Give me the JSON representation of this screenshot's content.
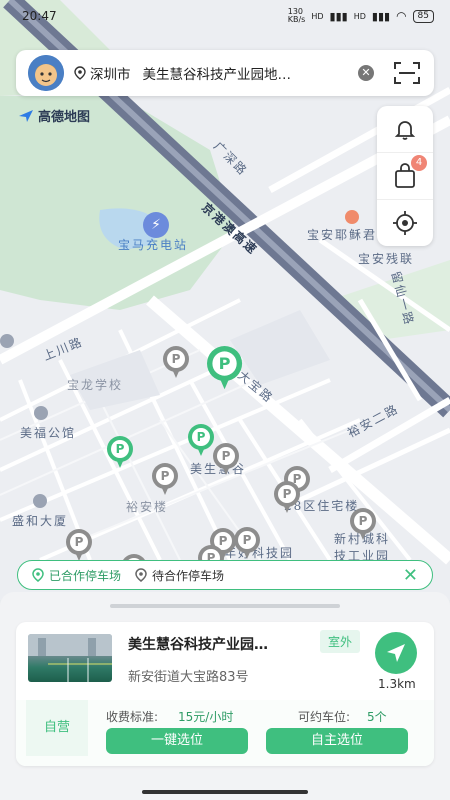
{
  "status_bar": {
    "time": "20:47",
    "net_speed": "130\nKB/s",
    "net1": "HD",
    "net2": "HD",
    "battery": "85"
  },
  "search": {
    "city": "深圳市",
    "query": "美生慧谷科技产业园地…"
  },
  "map": {
    "logo": "高德地图",
    "labels": {
      "guangshen_road": "广深路",
      "expressway": "京港澳高速",
      "bmw_station": "宝马充电站",
      "baoan_church": "宝安耶稣君",
      "baoan_disabled": "宝安残联",
      "liuxian_road": "留仙一路",
      "shangchuan_road": "上川路",
      "baolong_school": "宝龙学校",
      "dabao_road": "大宝路",
      "yuan_road": "裕安二路",
      "meifu": "美福公馆",
      "meisheng": "美生慧谷",
      "yuan_building": "裕安楼",
      "district28": "28区住宅楼",
      "shenghe": "盛和大厦",
      "xincun": "新村城科",
      "tech_industry": "技工业园",
      "tech_park": "年好科技园"
    }
  },
  "tools": {
    "cart_badge": "4"
  },
  "legend": {
    "cooperated": "已合作停车场",
    "pending": "待合作停车场"
  },
  "lot": {
    "name": "美生慧谷科技产业园…",
    "tag": "室外",
    "address": "新安街道大宝路83号",
    "distance": "1.3km",
    "ops": "自营",
    "fee_label": "收费标准:",
    "fee_value": "15元/小时",
    "avail_label": "可约车位:",
    "avail_value": "5个",
    "btn_quick": "一键选位",
    "btn_self": "自主选位"
  },
  "colors": {
    "accent": "#3fbf7f",
    "pin_gray": "#8d8d8d",
    "badge": "#f08575"
  }
}
